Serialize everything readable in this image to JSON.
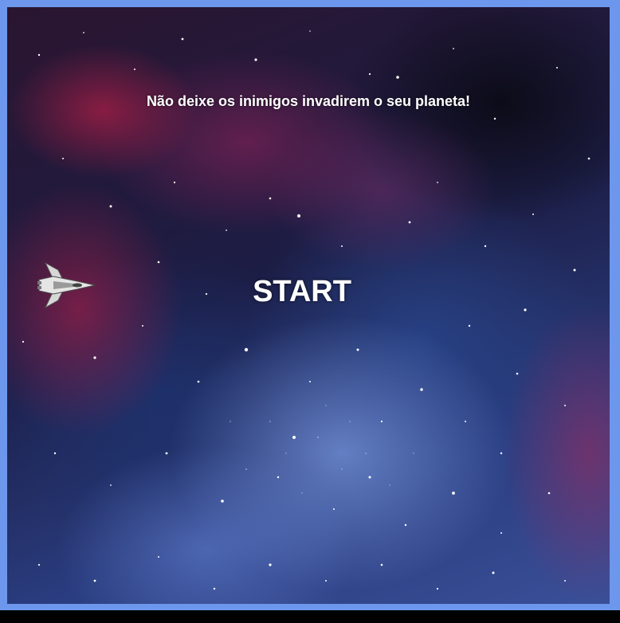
{
  "game": {
    "tagline": "Não deixe os inimigos invadirem o seu planeta!",
    "start_label": "START",
    "player_icon": "spaceship-icon"
  },
  "colors": {
    "frame_border": "#6d97ec",
    "text": "#ffffff"
  }
}
